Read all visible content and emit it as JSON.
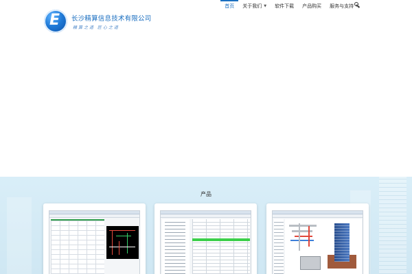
{
  "brand": {
    "logo_letter": "E",
    "company_name": "长沙精算信息技术有限公司",
    "slogan": "精算之道 匠心之道",
    "accent_color": "#1b6fc0"
  },
  "nav": {
    "items": [
      {
        "label": "首页",
        "active": true,
        "has_dropdown": false
      },
      {
        "label": "关于我们",
        "active": false,
        "has_dropdown": true
      },
      {
        "label": "软件下载",
        "active": false,
        "has_dropdown": false
      },
      {
        "label": "产品购买",
        "active": false,
        "has_dropdown": false
      },
      {
        "label": "服务与支持",
        "active": false,
        "has_dropdown": true
      }
    ],
    "search_icon": "search-icon"
  },
  "products": {
    "title": "产品",
    "cards": [
      {
        "kind": "spreadsheet-and-cad-screenshot"
      },
      {
        "kind": "tree-and-table-screenshot"
      },
      {
        "kind": "3d-building-model-screenshot"
      }
    ]
  }
}
